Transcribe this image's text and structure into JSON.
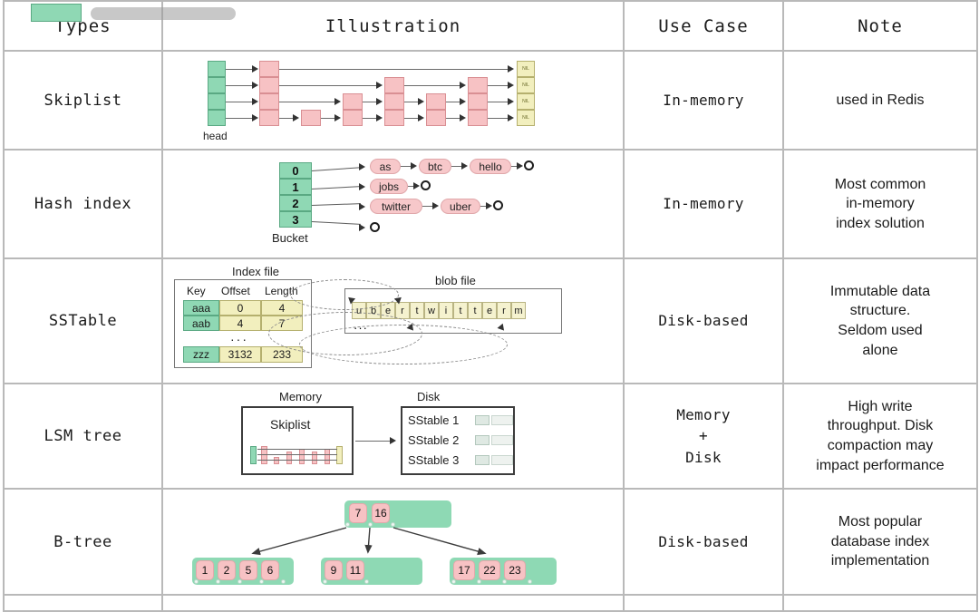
{
  "table": {
    "columns": [
      "Types",
      "Illustration",
      "Use Case",
      "Note"
    ],
    "rows": [
      {
        "type": "Skiplist",
        "use_case": "In-memory",
        "note": "used in Redis",
        "diagram": "skiplist",
        "diagram_labels": {
          "head": "head",
          "nil": "NIL"
        }
      },
      {
        "type": "Hash index",
        "use_case": "In-memory",
        "note": "Most common in-memory index solution",
        "note_lines": [
          "Most common",
          "in-memory",
          "index solution"
        ],
        "diagram": "hash-index",
        "diagram_labels": {
          "bucket": "Bucket"
        },
        "buckets": [
          "0",
          "1",
          "2",
          "3"
        ],
        "chains": [
          [
            "as",
            "btc",
            "hello"
          ],
          [
            "jobs"
          ],
          [
            "twitter",
            "uber"
          ],
          []
        ]
      },
      {
        "type": "SSTable",
        "use_case": "Disk-based",
        "note": "Immutable data structure. Seldom used alone",
        "note_lines": [
          "Immutable data",
          "structure.",
          "Seldom used",
          "alone"
        ],
        "diagram": "sstable",
        "diagram_labels": {
          "index_file": "Index file",
          "blob_file": "blob file",
          "ellipsis": "···"
        },
        "index_table": {
          "headers": [
            "Key",
            "Offset",
            "Length"
          ],
          "rows": [
            [
              "aaa",
              "0",
              "4"
            ],
            [
              "aab",
              "4",
              "7"
            ],
            [
              "zzz",
              "3132",
              "233"
            ]
          ],
          "gap_marker": "···"
        },
        "blob_chars": [
          "u",
          "b",
          "e",
          "r",
          "t",
          "w",
          "i",
          "t",
          "t",
          "e",
          "r",
          "m"
        ]
      },
      {
        "type": "LSM tree",
        "use_case": "Memory + Disk",
        "use_case_lines": [
          "Memory",
          "+",
          "Disk"
        ],
        "note": "High write throughput. Disk compaction may impact performance",
        "note_lines": [
          "High write",
          "throughput. Disk",
          "compaction may",
          "impact performance"
        ],
        "diagram": "lsm-tree",
        "diagram_labels": {
          "memory": "Memory",
          "disk": "Disk",
          "skiplist": "Skiplist"
        },
        "sstables": [
          "SStable 1",
          "SStable 2",
          "SStable 3"
        ]
      },
      {
        "type": "B-tree",
        "use_case": "Disk-based",
        "note": "Most popular database index implementation",
        "note_lines": [
          "Most popular",
          "database index",
          "implementation"
        ],
        "diagram": "b-tree",
        "tree": {
          "root": [
            "7",
            "16"
          ],
          "children": [
            [
              "1",
              "2",
              "5",
              "6"
            ],
            [
              "9",
              "11"
            ],
            [
              "17",
              "22",
              "23"
            ]
          ]
        }
      }
    ]
  },
  "colors": {
    "header_bg": "#eeeeee",
    "border": "#b9b9b9",
    "green": "#8fd8b4",
    "pink": "#f7c2c4",
    "yellow": "#f2efbe",
    "text": "#1b1b1b"
  }
}
